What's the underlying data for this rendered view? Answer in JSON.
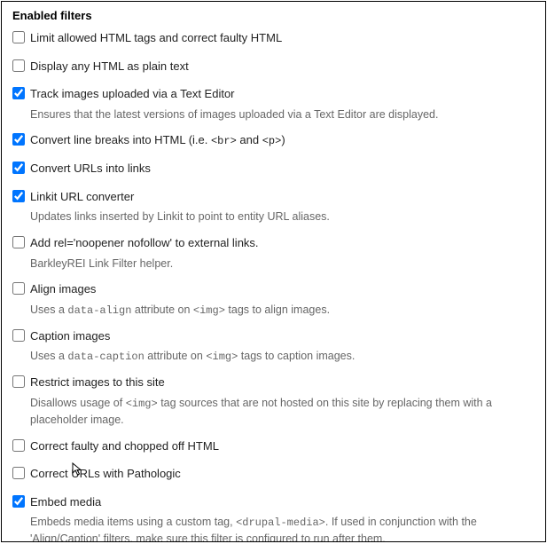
{
  "panel": {
    "title": "Enabled filters"
  },
  "filters": [
    {
      "checked": false,
      "label": "Limit allowed HTML tags and correct faulty HTML",
      "desc": null,
      "name": "filter-limit-html-tags"
    },
    {
      "checked": false,
      "label": "Display any HTML as plain text",
      "desc": null,
      "name": "filter-display-html-plain"
    },
    {
      "checked": true,
      "label": "Track images uploaded via a Text Editor",
      "desc": "Ensures that the latest versions of images uploaded via a Text Editor are displayed.",
      "name": "filter-track-images"
    },
    {
      "checked": true,
      "label_html": "Convert line breaks into HTML (i.e. <code>&lt;br&gt;</code> and <code>&lt;p&gt;</code>)",
      "desc": null,
      "name": "filter-convert-linebreaks"
    },
    {
      "checked": true,
      "label": "Convert URLs into links",
      "desc": null,
      "name": "filter-convert-urls"
    },
    {
      "checked": true,
      "label": "Linkit URL converter",
      "desc": "Updates links inserted by Linkit to point to entity URL aliases.",
      "name": "filter-linkit-url"
    },
    {
      "checked": false,
      "label": "Add rel='noopener nofollow' to external links.",
      "desc": "BarkleyREI Link Filter helper.",
      "name": "filter-add-rel-noopener"
    },
    {
      "checked": false,
      "label": "Align images",
      "desc_html": "Uses a <code>data-align</code> attribute on <code>&lt;img&gt;</code> tags to align images.",
      "name": "filter-align-images"
    },
    {
      "checked": false,
      "label": "Caption images",
      "desc_html": "Uses a <code>data-caption</code> attribute on <code>&lt;img&gt;</code> tags to caption images.",
      "name": "filter-caption-images"
    },
    {
      "checked": false,
      "label": "Restrict images to this site",
      "desc_html": "Disallows usage of <code>&lt;img&gt;</code> tag sources that are not hosted on this site by replacing them with a placeholder image.",
      "name": "filter-restrict-images"
    },
    {
      "checked": false,
      "label": "Correct faulty and chopped off HTML",
      "desc": null,
      "name": "filter-correct-faulty-html"
    },
    {
      "checked": false,
      "label": "Correct URLs with Pathologic",
      "desc": null,
      "name": "filter-correct-urls-pathologic"
    },
    {
      "checked": true,
      "label": "Embed media",
      "desc_html": "Embeds media items using a custom tag, <code>&lt;drupal-media&gt;</code>. If used in conjunction with the 'Align/Caption' filters, make sure this filter is configured to run after them.",
      "name": "filter-embed-media"
    }
  ]
}
